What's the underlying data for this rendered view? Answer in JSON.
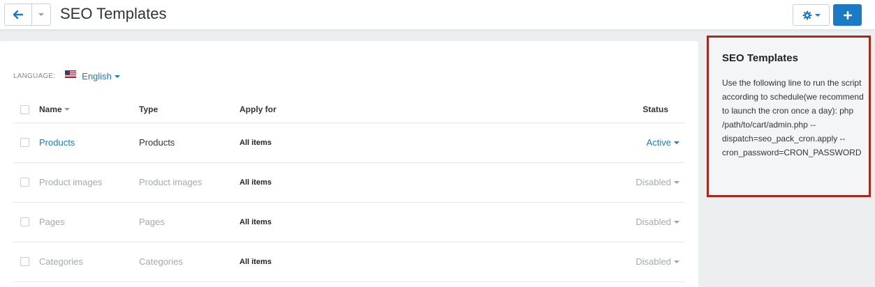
{
  "header": {
    "title": "SEO Templates",
    "back_icon": "arrow-left-icon",
    "settings_icon": "gear-icon",
    "add_icon": "plus-icon"
  },
  "language": {
    "label": "LANGUAGE:",
    "selected": "English",
    "flag": "us-flag-icon"
  },
  "table": {
    "headers": {
      "name": "Name",
      "type": "Type",
      "apply_for": "Apply for",
      "status": "Status"
    },
    "rows": [
      {
        "name": "Products",
        "type": "Products",
        "apply_for": "All items",
        "status": "Active"
      },
      {
        "name": "Product images",
        "type": "Product images",
        "apply_for": "All items",
        "status": "Disabled"
      },
      {
        "name": "Pages",
        "type": "Pages",
        "apply_for": "All items",
        "status": "Disabled"
      },
      {
        "name": "Categories",
        "type": "Categories",
        "apply_for": "All items",
        "status": "Disabled"
      }
    ]
  },
  "sidebar": {
    "title": "SEO Templates",
    "text": "Use the following line to run the script according to schedule(we recommend to launch the cron once a day): php /path/to/cart/admin.php --dispatch=seo_pack_cron.apply --cron_password=CRON_PASSWORD"
  },
  "colors": {
    "accent": "#1a7ac4",
    "highlight_border": "#a42b1b",
    "disabled_text": "#a4a9ae"
  }
}
